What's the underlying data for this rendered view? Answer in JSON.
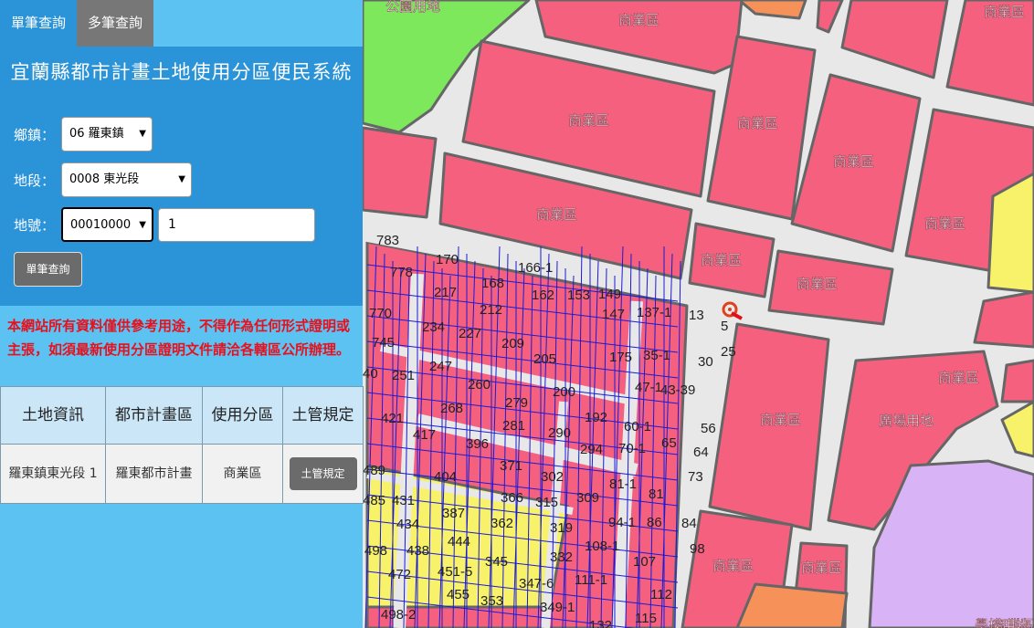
{
  "tabs": {
    "single": "單筆查詢",
    "multi": "多筆查詢"
  },
  "title": "宜蘭縣都市計畫土地使用分區便民系統",
  "form": {
    "township_label": "鄉鎮：",
    "township_value": "06 羅東鎮",
    "section_label": "地段：",
    "section_value": "0008 東光段",
    "lot_label": "地號：",
    "lot_main_value": "00010000",
    "lot_sub_value": "1",
    "query_button": "單筆查詢"
  },
  "notice": "本網站所有資料僅供參考用途，不得作為任何形式證明或主張，如須最新使用分區證明文件請洽各轄區公所辦理。",
  "table": {
    "headers": [
      "土地資訊",
      "都市計畫區",
      "使用分區",
      "土管規定"
    ],
    "row": {
      "land": "羅東鎮東光段 1",
      "plan": "羅東都市計畫",
      "zone": "商業區",
      "rule_button": "土管規定"
    }
  },
  "map": {
    "zone_labels": [
      "公園用地",
      "商業區",
      "商業區",
      "商業區",
      "商業區",
      "商業區",
      "商業區",
      "商業區",
      "商業區",
      "商業區",
      "商業區",
      "廣場用地",
      "商業區",
      "商業區",
      "商業區",
      "商業區",
      "學校用地"
    ],
    "parcel_labels": [
      "783",
      "170",
      "166-1",
      "778",
      "168",
      "162",
      "153",
      "149",
      "217",
      "212",
      "147",
      "137-1",
      "13",
      "770",
      "234",
      "227",
      "209",
      "5",
      "25",
      "745",
      "247",
      "205",
      "175",
      "35-1",
      "30",
      "40",
      "251",
      "260",
      "200",
      "47-1",
      "43-39",
      "279",
      "192",
      "268",
      "421",
      "417",
      "281",
      "290",
      "60-1",
      "56",
      "396",
      "294",
      "70-1",
      "65",
      "64",
      "489",
      "404",
      "371",
      "302",
      "73",
      "81-1",
      "485",
      "431",
      "387",
      "366",
      "315",
      "309",
      "81",
      "434",
      "362",
      "319",
      "94-1",
      "86",
      "84",
      "498",
      "438",
      "444",
      "108-1",
      "98",
      "345",
      "332",
      "472",
      "451-5",
      "107",
      "111-1",
      "347-6",
      "455",
      "353",
      "112",
      "498-2",
      "349-1",
      "115",
      "132"
    ],
    "colors": {
      "commercial": "#f5607e",
      "park": "#7de85b",
      "residential": "#f7f26a",
      "school": "#d8b4f7",
      "orange": "#f6915a",
      "road": "#e8e8e8",
      "boundary": "#1a1ad8"
    }
  }
}
